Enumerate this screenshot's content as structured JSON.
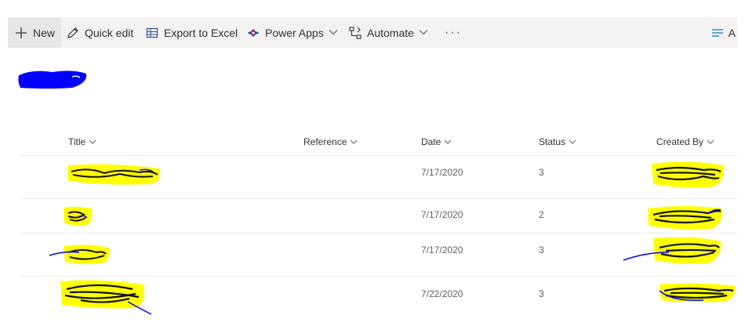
{
  "command_bar": {
    "new_label": "New",
    "quick_edit_label": "Quick edit",
    "export_label": "Export to Excel",
    "power_apps_label": "Power Apps",
    "automate_label": "Automate",
    "more_label": "···",
    "view_label": "A"
  },
  "list": {
    "columns": [
      "Title",
      "Reference",
      "Date",
      "Status",
      "Created By"
    ],
    "rows": [
      {
        "date": "7/17/2020",
        "status": "3"
      },
      {
        "date": "7/17/2020",
        "status": "2"
      },
      {
        "date": "7/17/2020",
        "status": "3"
      },
      {
        "date": "7/22/2020",
        "status": "3"
      }
    ]
  },
  "colors": {
    "command_bar_bg": "#f3f2f1",
    "accent": "#0078d4",
    "redaction_highlight": "#ffff00",
    "redaction_blue": "#0000ff"
  }
}
